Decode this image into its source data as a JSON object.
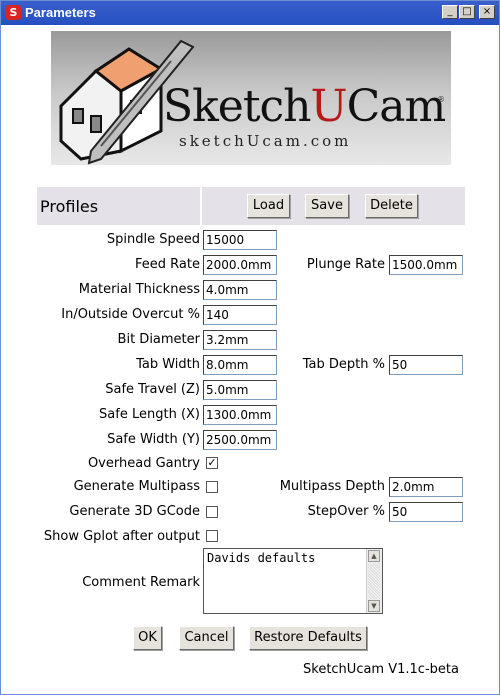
{
  "window": {
    "title": "Parameters",
    "app_icon": "S",
    "controls": {
      "minimize": "_",
      "maximize": "□",
      "close": "×"
    }
  },
  "logo": {
    "brand_prefix": "Sketch",
    "brand_u": "U",
    "brand_suffix": "Cam",
    "registered": "®",
    "url": "sketchUcam.com",
    "icon": "house-with-router-bit-logo"
  },
  "profiles": {
    "label": "Profiles",
    "load": "Load",
    "save": "Save",
    "delete": "Delete"
  },
  "fields": {
    "spindle_speed": {
      "label": "Spindle Speed",
      "value": "15000"
    },
    "feed_rate": {
      "label": "Feed Rate",
      "value": "2000.0mm"
    },
    "plunge_rate": {
      "label": "Plunge Rate",
      "value": "1500.0mm"
    },
    "material_thickness": {
      "label": "Material Thickness",
      "value": "4.0mm"
    },
    "overcut": {
      "label": "In/Outside Overcut %",
      "value": "140"
    },
    "bit_diameter": {
      "label": "Bit Diameter",
      "value": "3.2mm"
    },
    "tab_width": {
      "label": "Tab Width",
      "value": "8.0mm"
    },
    "tab_depth": {
      "label": "Tab Depth %",
      "value": "50"
    },
    "safe_travel": {
      "label": "Safe Travel (Z)",
      "value": "5.0mm"
    },
    "safe_length": {
      "label": "Safe Length (X)",
      "value": "1300.0mm"
    },
    "safe_width": {
      "label": "Safe Width (Y)",
      "value": "2500.0mm"
    },
    "multipass_depth": {
      "label": "Multipass Depth",
      "value": "2.0mm"
    },
    "stepover": {
      "label": "StepOver %",
      "value": "50"
    }
  },
  "checks": {
    "overhead_gantry": {
      "label": "Overhead Gantry",
      "checked": true,
      "mark": "✓"
    },
    "generate_multipass": {
      "label": "Generate Multipass",
      "checked": false
    },
    "generate_3d": {
      "label": "Generate 3D GCode",
      "checked": false
    },
    "show_gplot": {
      "label": "Show Gplot after output",
      "checked": false
    }
  },
  "comment": {
    "label": "Comment Remark",
    "value": "Davids defaults"
  },
  "buttons": {
    "ok": "OK",
    "cancel": "Cancel",
    "restore": "Restore Defaults"
  },
  "version": "SketchUcam V1.1c-beta"
}
